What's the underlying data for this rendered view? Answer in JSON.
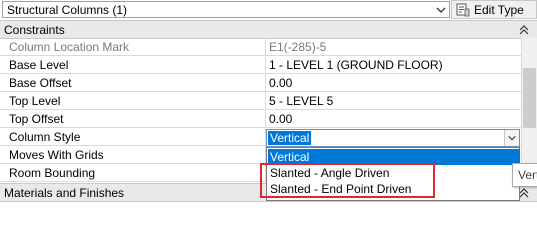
{
  "header": {
    "type_selector": "Structural Columns (1)",
    "edit_type_label": "Edit Type"
  },
  "categories": {
    "constraints": "Constraints",
    "materials": "Materials and Finishes"
  },
  "rows": [
    {
      "name": "Column Location Mark",
      "value": "E1(-285)-5",
      "readonly": true
    },
    {
      "name": "Base Level",
      "value": "1 - LEVEL 1 (GROUND FLOOR)"
    },
    {
      "name": "Base Offset",
      "value": "0.00"
    },
    {
      "name": "Top Level",
      "value": "5 - LEVEL 5"
    },
    {
      "name": "Top Offset",
      "value": "0.00"
    },
    {
      "name": "Column Style",
      "value": "Vertical"
    },
    {
      "name": "Moves With Grids",
      "value": ""
    },
    {
      "name": "Room Bounding",
      "value": ""
    }
  ],
  "dropdown": {
    "options": [
      "Vertical",
      "Slanted - Angle Driven",
      "Slanted - End Point Driven"
    ],
    "selected": "Vertical"
  },
  "tooltip": "Vert",
  "colors": {
    "accent": "#0078d7",
    "annotation": "#e0262f",
    "header_bg": "#e9e9e9"
  },
  "icons": [
    "chevron-down-icon",
    "edit-type-icon",
    "chevron-up-icon"
  ]
}
